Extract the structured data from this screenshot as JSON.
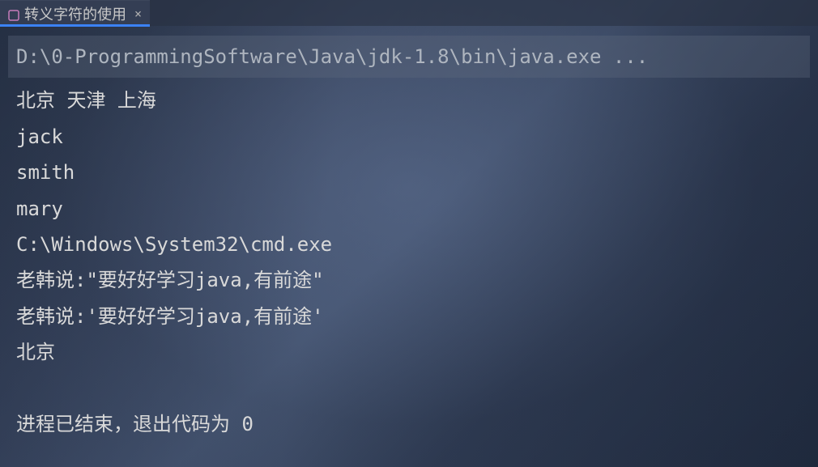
{
  "tab": {
    "title": "转义字符的使用",
    "close_glyph": "×"
  },
  "console": {
    "command": "D:\\0-ProgrammingSoftware\\Java\\jdk-1.8\\bin\\java.exe ...",
    "lines": [
      "北京 天津 上海",
      "jack",
      "smith",
      "mary",
      "C:\\Windows\\System32\\cmd.exe",
      "老韩说:\"要好好学习java,有前途\"",
      "老韩说:'要好好学习java,有前途'",
      "北京"
    ],
    "exit_message": "进程已结束，退出代码为 0"
  }
}
